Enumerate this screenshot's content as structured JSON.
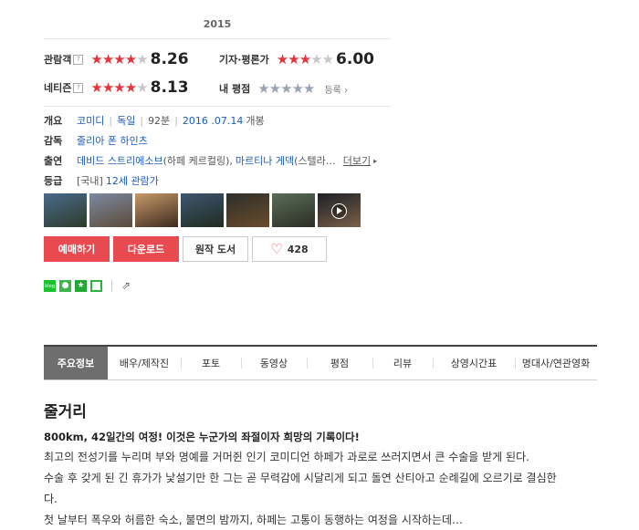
{
  "year": "2015",
  "ratings": {
    "audience": {
      "label": "관람객",
      "help": "?",
      "score": "8.26",
      "stars": 4
    },
    "critic": {
      "label": "기자·평론가",
      "score": "6.00",
      "stars": 3
    },
    "netizen": {
      "label": "네티즌",
      "help": "?",
      "score": "8.13",
      "stars": 4
    },
    "my": {
      "label": "내 평점",
      "register": "등록"
    }
  },
  "info": {
    "overview": {
      "label": "개요",
      "genre": "코미디",
      "country": "독일",
      "runtime": "92분",
      "release": "2016 .07.14",
      "release_suffix": "개봉"
    },
    "director": {
      "label": "감독",
      "name": "줄리아 폰 하인츠"
    },
    "cast": {
      "label": "출연",
      "actor1": "데비드 스트리에소브",
      "role1": "(하페 케르컬링),",
      "actor2": "마르티나 게덱",
      "role2": "(스텔라…",
      "more": "더보기"
    },
    "grade": {
      "label": "등급",
      "region": "[국내]",
      "value": "12세 관람가"
    }
  },
  "stills": [
    {
      "name": "still-1",
      "grad": [
        "#4a6a8c",
        "#2d3b2a"
      ]
    },
    {
      "name": "still-2",
      "grad": [
        "#7c8aa0",
        "#5b4a3a"
      ]
    },
    {
      "name": "still-3",
      "grad": [
        "#c79a6a",
        "#3d2a1e"
      ]
    },
    {
      "name": "still-4",
      "grad": [
        "#3f5670",
        "#1f2c1f"
      ]
    },
    {
      "name": "still-5",
      "grad": [
        "#2c2f2a",
        "#6b4b2c"
      ]
    },
    {
      "name": "still-6",
      "grad": [
        "#5a6e58",
        "#2b2d24"
      ]
    },
    {
      "name": "still-7",
      "grad": [
        "#1d2026",
        "#7a6048"
      ],
      "video": true
    }
  ],
  "buttons": {
    "reserve": "예매하기",
    "download": "다운로드",
    "original": "원작 도서",
    "like_count": "428"
  },
  "social": {
    "naver": "blog"
  },
  "tabs": [
    "주요정보",
    "배우/제작진",
    "포토",
    "동영상",
    "평점",
    "리뷰",
    "상영시간표",
    "명대사/연관영화"
  ],
  "synopsis": {
    "title": "줄거리",
    "headline": "800km, 42일간의 여정! 이것은 누군가의 좌절이자 희망의 기록이다!",
    "lines": [
      "최고의 전성기를 누리며 부와 명예를 거머쥔 인기 코미디언 하페가 과로로 쓰러지면서 큰 수술을 받게 된다.",
      " 수술 후 갖게 된 긴 휴가가 낯설기만 한 그는 곧 무력감에 시달리게 되고 돌연 산티아고 순례길에 오르기로 결심한",
      "다.",
      " 첫 날부터 폭우와 허름한 숙소, 불면의 밤까지, 하페는 고통이 동행하는 여정을 시작하는데…"
    ]
  },
  "colors": {
    "accent_red": "#e84a4f",
    "link_blue": "#1a5bbf",
    "tab_active": "#6e6e6e"
  }
}
